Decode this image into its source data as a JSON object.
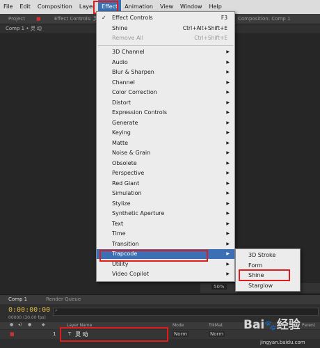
{
  "menubar": {
    "items": [
      "File",
      "Edit",
      "Composition",
      "Layer",
      "Effect",
      "Animation",
      "View",
      "Window",
      "Help"
    ]
  },
  "tabs": {
    "project": "Project",
    "effect_controls": "Effect Controls: 灵",
    "composition": "Composition: Comp 1"
  },
  "comp_breadcrumb": "Comp 1 • 灵 动",
  "viewer": {
    "zoom": "50%"
  },
  "effect_menu": {
    "effect_controls": {
      "label": "Effect Controls",
      "shortcut": "F3",
      "checked": "✓"
    },
    "shine": {
      "label": "Shine",
      "shortcut": "Ctrl+Alt+Shift+E"
    },
    "remove_all": {
      "label": "Remove All",
      "shortcut": "Ctrl+Shift+E"
    },
    "categories": [
      "3D Channel",
      "Audio",
      "Blur & Sharpen",
      "Channel",
      "Color Correction",
      "Distort",
      "Expression Controls",
      "Generate",
      "Keying",
      "Matte",
      "Noise & Grain",
      "Obsolete",
      "Perspective",
      "Red Giant",
      "Simulation",
      "Stylize",
      "Synthetic Aperture",
      "Text",
      "Time",
      "Transition",
      "Trapcode",
      "Utility",
      "Video Copilot"
    ]
  },
  "trapcode_menu": {
    "items": [
      "3D Stroke",
      "Form",
      "Shine",
      "Starglow"
    ]
  },
  "timeline": {
    "tab_comp": "Comp 1",
    "tab_render": "Render Queue",
    "timecode": "0:00:00:00",
    "frames": "00000 (30.00 fps)",
    "col_layer_name": "Layer Name",
    "col_mode": "Mode",
    "col_trkmat": "TrkMat",
    "col_parent": "Parent",
    "layer_index": "1",
    "layer_name": "灵 动",
    "layer_mode": "Norm",
    "layer_mode2": "Norm"
  },
  "watermark": {
    "brand": "Bai",
    "brand2": "经验",
    "url": "jingyan.baidu.com"
  },
  "colors": {
    "highlight": "#3b6fb6",
    "annotation_red": "#e01b1b",
    "timecode": "#d8b341"
  }
}
